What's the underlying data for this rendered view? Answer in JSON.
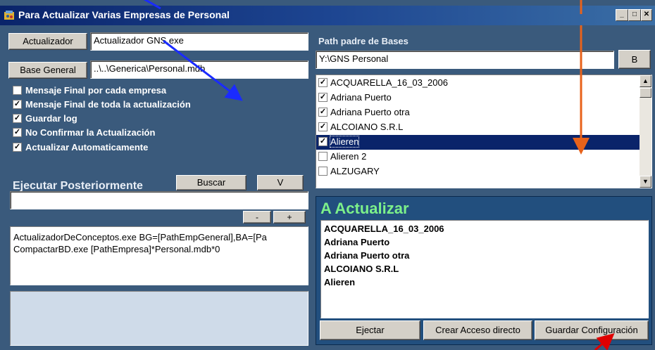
{
  "window": {
    "title": "Para Actualizar Varias Empresas de Personal",
    "min_label": "_",
    "max_label": "□",
    "close_label": "✕"
  },
  "left": {
    "actualizador_button": "Actualizador",
    "actualizador_value": "Actualizador GNS.exe",
    "base_general_button": "Base General",
    "base_general_value": "..\\..\\Generica\\Personal.mdb",
    "options": [
      {
        "label": "Mensaje Final por cada empresa",
        "checked": false
      },
      {
        "label": "Mensaje Final de toda la actualización",
        "checked": true
      },
      {
        "label": "Guardar log",
        "checked": true
      },
      {
        "label": "No Confirmar la Actualización",
        "checked": true
      },
      {
        "label": "Actualizar Automaticamente",
        "checked": true
      }
    ],
    "ejecutar_label": "Ejecutar Posteriormente",
    "buscar_button": "Buscar",
    "v_button": "V",
    "command_input": "",
    "minus_button": "-",
    "plus_button": "+",
    "commands": [
      "ActualizadorDeConceptos.exe BG=[PathEmpGeneral],BA=[Pa",
      "CompactarBD.exe [PathEmpresa]*Personal.mdb*0"
    ]
  },
  "right": {
    "path_label": "Path padre de Bases",
    "path_value": "Y:\\GNS Personal",
    "b_button": "B",
    "companies": [
      {
        "name": "ACQUARELLA_16_03_2006",
        "checked": true,
        "selected": false
      },
      {
        "name": "Adriana Puerto",
        "checked": true,
        "selected": false
      },
      {
        "name": "Adriana Puerto otra",
        "checked": true,
        "selected": false
      },
      {
        "name": "ALCOIANO S.R.L",
        "checked": true,
        "selected": false
      },
      {
        "name": "Alieren",
        "checked": true,
        "selected": true
      },
      {
        "name": "Alieren 2",
        "checked": false,
        "selected": false
      },
      {
        "name": "ALZUGARY",
        "checked": false,
        "selected": false
      }
    ],
    "a_actualizar_title": "A Actualizar",
    "to_update": [
      "ACQUARELLA_16_03_2006",
      "Adriana Puerto",
      "Adriana Puerto otra",
      "ALCOIANO S.R.L",
      "Alieren"
    ],
    "ejecutar_button": "Ejectar",
    "crear_acceso_button": "Crear Acceso directo",
    "guardar_config_button": "Guardar Configuración"
  },
  "colors": {
    "panel": "#3a5a7c",
    "title": "#0a246a",
    "a_actualizar_text": "#7cf08a",
    "annotation_blue": "#1a2bff",
    "annotation_orange": "#e8621a",
    "annotation_red": "#e00000"
  }
}
